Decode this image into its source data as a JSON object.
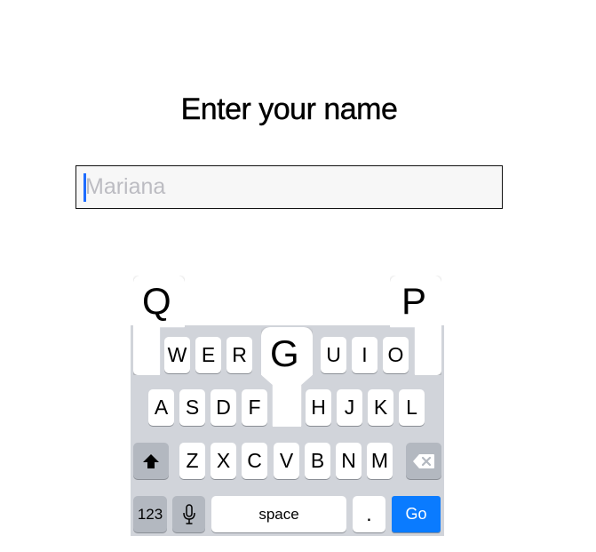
{
  "heading": "Enter your name",
  "name_field": {
    "value": "",
    "placeholder": "Mariana"
  },
  "keyboard": {
    "row1": [
      "W",
      "E",
      "R",
      "U",
      "I",
      "O"
    ],
    "row2": [
      "A",
      "S",
      "D",
      "F",
      "H",
      "J",
      "K",
      "L"
    ],
    "row3": [
      "Z",
      "X",
      "C",
      "V",
      "B",
      "N",
      "M"
    ],
    "popups": {
      "q": "Q",
      "p": "P",
      "g": "G"
    },
    "numbers_label": "123",
    "space_label": "space",
    "period_label": ".",
    "go_label": "Go",
    "shift_icon": "shift-icon",
    "delete_icon": "delete-icon",
    "mic_icon": "microphone-icon"
  },
  "colors": {
    "caret": "#1e6cff",
    "go_key": "#0a7bff",
    "keyboard_bg": "#d1d4da"
  }
}
